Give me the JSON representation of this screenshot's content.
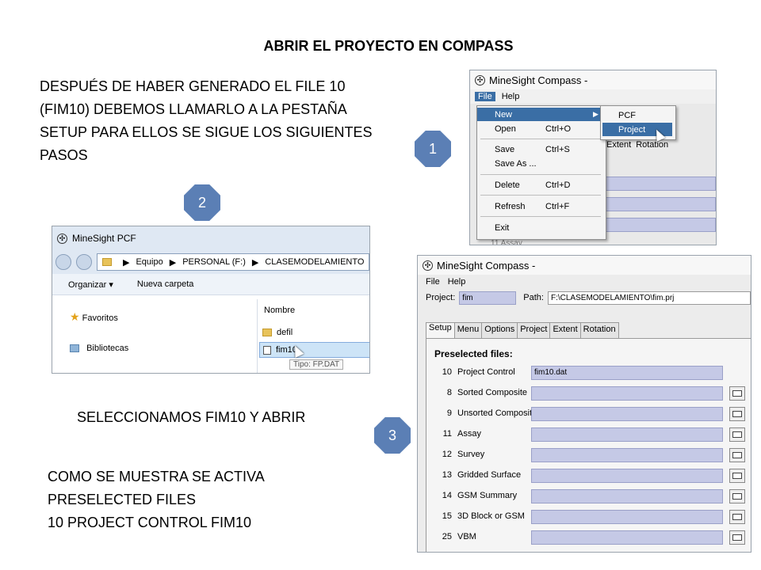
{
  "slide": {
    "title": "ABRIR EL PROYECTO EN COMPASS",
    "intro_lines": [
      "DESPUÉS DE HABER GENERADO EL FILE 10",
      "(FIM10) DEBEMOS LLAMARLO A LA PESTAÑA",
      "SETUP PARA ELLOS SE SIGUE LOS SIGUIENTES",
      "PASOS"
    ],
    "caption_select": "SELECCIONAMOS FIM10 Y ABRIR",
    "caption_active_lines": [
      "COMO SE MUESTRA SE ACTIVA",
      "PRESELECTED FILES",
      "10 PROJECT CONTROL FIM10"
    ],
    "badges": [
      "1",
      "2",
      "3"
    ],
    "badge_color": "#5b7fb5"
  },
  "window1": {
    "title": "MineSight Compass -",
    "menu": [
      "File",
      "Help"
    ],
    "file_menu": [
      {
        "label": "New",
        "key": "",
        "arrow": "▶"
      },
      {
        "label": "Open",
        "key": "Ctrl+O"
      },
      {
        "label": "Save",
        "key": "Ctrl+S"
      },
      {
        "label": "Save As ...",
        "key": ""
      },
      {
        "label": "Delete",
        "key": "Ctrl+D"
      },
      {
        "label": "Refresh",
        "key": "Ctrl+F"
      },
      {
        "label": "Exit",
        "key": ""
      }
    ],
    "submenu": [
      "PCF",
      "Project"
    ],
    "behind_tabs": [
      "Extent",
      "Rotation"
    ],
    "behind_row": "11  Assay"
  },
  "window2": {
    "title": "MineSight PCF",
    "address": [
      "Equipo",
      "PERSONAL (F:)",
      "CLASEMODELAMIENTO"
    ],
    "commands": [
      "Organizar ▾",
      "Nueva carpeta"
    ],
    "nav": [
      "Favoritos",
      "Bibliotecas"
    ],
    "column": "Nombre",
    "files": [
      "defil",
      "fim10"
    ],
    "tooltip": "Tipo: FP.DAT"
  },
  "window3": {
    "title": "MineSight Compass -",
    "menu": [
      "File",
      "Help"
    ],
    "project_label": "Project:",
    "project_value": "fim",
    "path_label": "Path:",
    "path_value": "F:\\CLASEMODELAMIENTO\\fim.prj",
    "tabs": [
      "Setup",
      "Menu",
      "Options",
      "Project",
      "Extent",
      "Rotation"
    ],
    "section": "Preselected files:",
    "files": [
      {
        "num": "10",
        "label": "Project Control",
        "value": "fim10.dat"
      },
      {
        "num": "8",
        "label": "Sorted Composite",
        "value": ""
      },
      {
        "num": "9",
        "label": "Unsorted Composite",
        "value": ""
      },
      {
        "num": "11",
        "label": "Assay",
        "value": ""
      },
      {
        "num": "12",
        "label": "Survey",
        "value": ""
      },
      {
        "num": "13",
        "label": "Gridded Surface",
        "value": ""
      },
      {
        "num": "14",
        "label": "GSM Summary",
        "value": ""
      },
      {
        "num": "15",
        "label": "3D Block or GSM",
        "value": ""
      },
      {
        "num": "25",
        "label": "VBM",
        "value": ""
      }
    ]
  }
}
